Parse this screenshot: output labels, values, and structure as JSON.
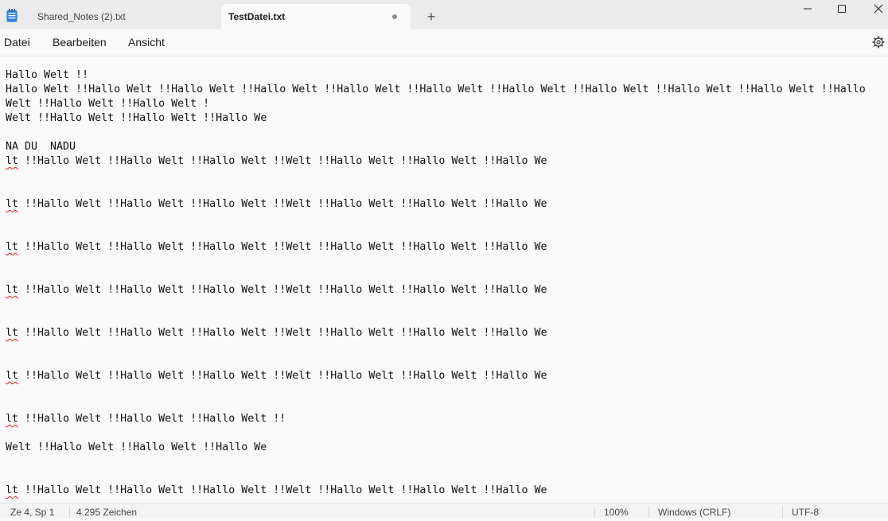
{
  "tabs": [
    {
      "label": "Shared_Notes (2).txt",
      "active": false
    },
    {
      "label": "TestDatei.txt",
      "active": true,
      "unsaved": true
    }
  ],
  "new_tab_label": "+",
  "menu": {
    "file": "Datei",
    "edit": "Bearbeiten",
    "view": "Ansicht"
  },
  "editor": {
    "lines": [
      {
        "text": "Hallo Welt !!"
      },
      {
        "text": "Hallo Welt !!Hallo Welt !!Hallo Welt !!Hallo Welt !!Hallo Welt !!Hallo Welt !!Hallo Welt !!Hallo Welt !!Hallo Welt !!Hallo Welt !!Hallo"
      },
      {
        "text": "Welt !!Hallo Welt !!Hallo Welt !"
      },
      {
        "text": "Welt !!Hallo Welt !!Hallo Welt !!Hallo We"
      },
      {
        "text": ""
      },
      {
        "text": "NA DU  NADU"
      },
      {
        "lead": "lt",
        "rest": " !!Hallo Welt !!Hallo Welt !!Hallo Welt !!Welt !!Hallo Welt !!Hallo Welt !!Hallo We"
      },
      {
        "text": ""
      },
      {
        "text": ""
      },
      {
        "lead": "lt",
        "rest": " !!Hallo Welt !!Hallo Welt !!Hallo Welt !!Welt !!Hallo Welt !!Hallo Welt !!Hallo We"
      },
      {
        "text": ""
      },
      {
        "text": ""
      },
      {
        "lead": "lt",
        "rest": " !!Hallo Welt !!Hallo Welt !!Hallo Welt !!Welt !!Hallo Welt !!Hallo Welt !!Hallo We"
      },
      {
        "text": ""
      },
      {
        "text": ""
      },
      {
        "lead": "lt",
        "rest": " !!Hallo Welt !!Hallo Welt !!Hallo Welt !!Welt !!Hallo Welt !!Hallo Welt !!Hallo We"
      },
      {
        "text": ""
      },
      {
        "text": ""
      },
      {
        "lead": "lt",
        "rest": " !!Hallo Welt !!Hallo Welt !!Hallo Welt !!Welt !!Hallo Welt !!Hallo Welt !!Hallo We"
      },
      {
        "text": ""
      },
      {
        "text": ""
      },
      {
        "lead": "lt",
        "rest": " !!Hallo Welt !!Hallo Welt !!Hallo Welt !!Welt !!Hallo Welt !!Hallo Welt !!Hallo We"
      },
      {
        "text": ""
      },
      {
        "text": ""
      },
      {
        "lead": "lt",
        "rest": " !!Hallo Welt !!Hallo Welt !!Hallo Welt !!"
      },
      {
        "text": ""
      },
      {
        "text": "Welt !!Hallo Welt !!Hallo Welt !!Hallo We"
      },
      {
        "text": ""
      },
      {
        "text": ""
      },
      {
        "lead": "lt",
        "rest": " !!Hallo Welt !!Hallo Welt !!Hallo Welt !!Welt !!Hallo Welt !!Hallo Welt !!Hallo We"
      }
    ]
  },
  "status": {
    "position": "Ze 4, Sp 1",
    "chars": "4.295 Zeichen",
    "zoom": "100%",
    "line_ending": "Windows (CRLF)",
    "encoding": "UTF-8"
  },
  "icons": {
    "app": "notepad-icon",
    "settings": "gear-icon",
    "minimize": "minimize-icon",
    "maximize": "maximize-icon",
    "close": "close-icon"
  }
}
